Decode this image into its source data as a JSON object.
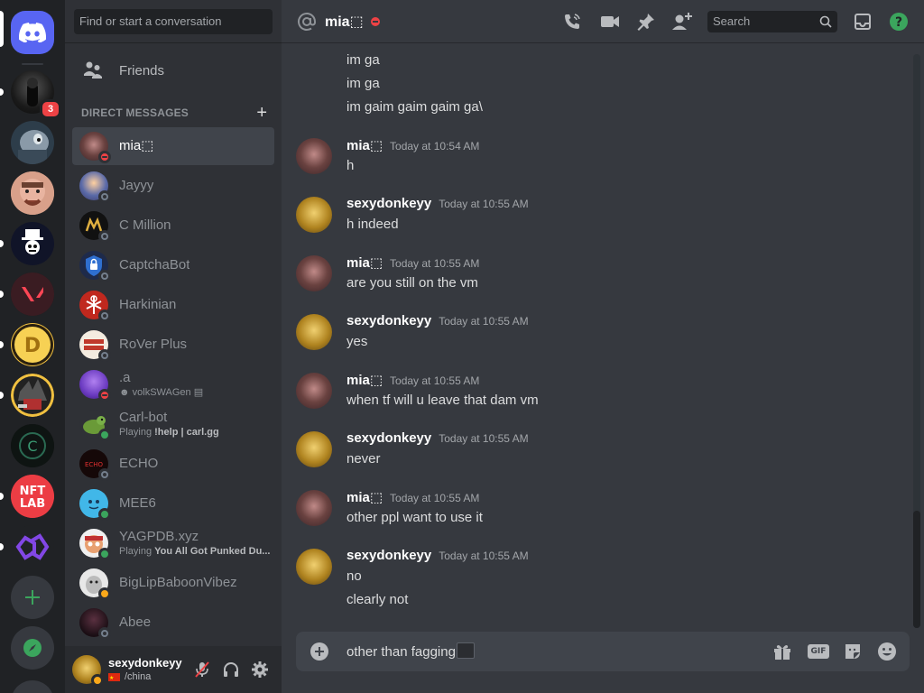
{
  "search_placeholder": "Find or start a conversation",
  "friends_label": "Friends",
  "direct_messages_title": "DIRECT MESSAGES",
  "server_badge_count": "3",
  "dms": [
    {
      "name": "mia⬚",
      "status": "dnd",
      "sub": "",
      "active": true
    },
    {
      "name": "Jayyy",
      "status": "offline",
      "sub": ""
    },
    {
      "name": "C Million",
      "status": "offline",
      "sub": ""
    },
    {
      "name": "CaptchaBot",
      "status": "offline",
      "sub": ""
    },
    {
      "name": "Harkinian",
      "status": "offline",
      "sub": ""
    },
    {
      "name": "RoVer Plus",
      "status": "offline",
      "sub": ""
    },
    {
      "name": ".a",
      "status": "dnd",
      "sub": "volkSWAGen"
    },
    {
      "name": "Carl-bot",
      "status": "online",
      "sub_prefix": "Playing ",
      "sub_bold": "!help | carl.gg"
    },
    {
      "name": "ECHO",
      "status": "offline",
      "sub": ""
    },
    {
      "name": "MEE6",
      "status": "online",
      "sub": ""
    },
    {
      "name": "YAGPDB.xyz",
      "status": "online",
      "sub_prefix": "Playing ",
      "sub_bold": "You All Got Punked Du..."
    },
    {
      "name": "BigLipBaboonVibez",
      "status": "idle",
      "sub": ""
    },
    {
      "name": "Abee",
      "status": "offline",
      "sub": ""
    }
  ],
  "user": {
    "name": "sexydonkeyy",
    "status_text": "/china"
  },
  "channel": {
    "name": "mia⬚",
    "search_placeholder": "Search"
  },
  "messages": {
    "cont_lines": [
      "im ga",
      "im ga",
      "im gaim gaim gaim ga\\"
    ],
    "groups": [
      {
        "author": "mia⬚",
        "time": "Today at 10:54 AM",
        "lines": [
          "h"
        ]
      },
      {
        "author": "sexydonkeyy",
        "time": "Today at 10:55 AM",
        "lines": [
          "h indeed"
        ]
      },
      {
        "author": "mia⬚",
        "time": "Today at 10:55 AM",
        "lines": [
          "are you still on the vm"
        ]
      },
      {
        "author": "sexydonkeyy",
        "time": "Today at 10:55 AM",
        "lines": [
          "yes"
        ]
      },
      {
        "author": "mia⬚",
        "time": "Today at 10:55 AM",
        "lines": [
          "when tf will u leave that dam vm"
        ]
      },
      {
        "author": "sexydonkeyy",
        "time": "Today at 10:55 AM",
        "lines": [
          "never"
        ]
      },
      {
        "author": "mia⬚",
        "time": "Today at 10:55 AM",
        "lines": [
          "other ppl want to use it"
        ]
      },
      {
        "author": "sexydonkeyy",
        "time": "Today at 10:55 AM",
        "lines": [
          "no",
          "clearly not"
        ]
      }
    ]
  },
  "composer": {
    "text": "other than fagging",
    "gif_label": "GIF"
  },
  "colors": {
    "blurple": "#5865f2",
    "online": "#3ba55d",
    "dnd": "#ed4245",
    "idle": "#faa81a",
    "offline": "#747f8d"
  }
}
